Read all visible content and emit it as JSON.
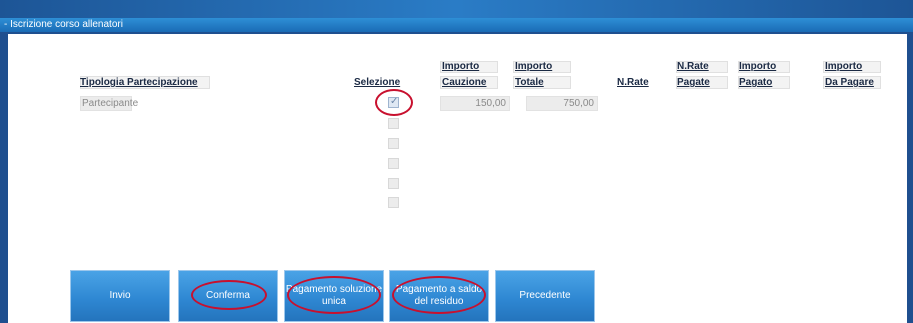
{
  "window": {
    "title": "- Iscrizione corso allenatori"
  },
  "table": {
    "headers": {
      "tipologia": "Tipologia Partecipazione",
      "selezione": "Selezione",
      "cauzione_top": "Importo",
      "cauzione_bottom": "Cauzione",
      "totale_top": "Importo",
      "totale_bottom": "Totale",
      "nrate": "N.Rate",
      "rate_pagate_top": "N.Rate",
      "rate_pagate_bottom": "Pagate",
      "pagato_top": "Importo",
      "pagato_bottom": "Pagato",
      "dapagare_top": "Importo",
      "dapagare_bottom": "Da Pagare"
    },
    "rows": [
      {
        "tipologia": "Partecipante",
        "checked": true,
        "cauzione": "150,00",
        "totale": "750,00"
      }
    ]
  },
  "buttons": {
    "invio": "Invio",
    "conferma": "Conferma",
    "pagamento_unica": "Pagamento soluzione unica",
    "pagamento_saldo": "Pagamento a saldo del residuo",
    "precedente": "Precedente"
  },
  "colors": {
    "accent": "#2f88d3",
    "highlight": "#c8102e"
  }
}
